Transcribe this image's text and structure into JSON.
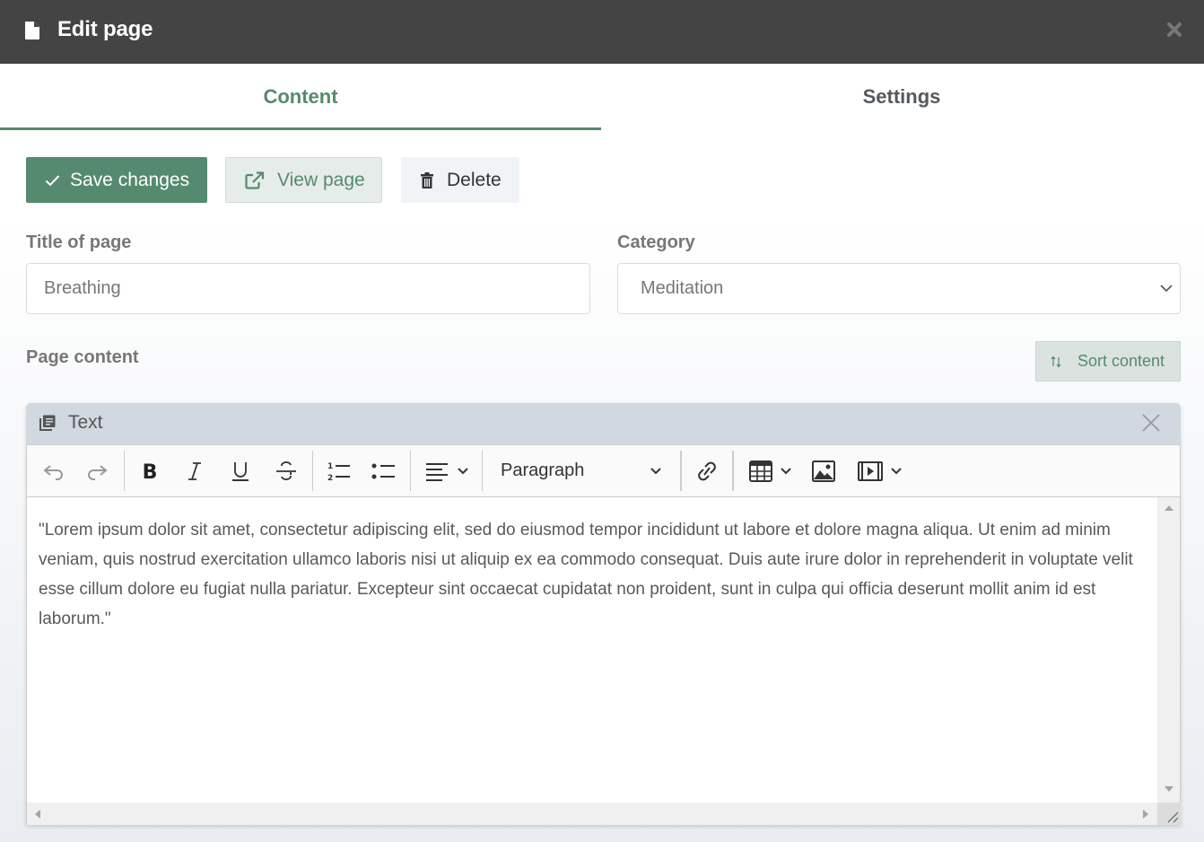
{
  "window": {
    "title": "Edit page",
    "title_icon": "file-icon",
    "close_icon": "close-icon"
  },
  "tabs": [
    {
      "label": "Content",
      "active": true
    },
    {
      "label": "Settings",
      "active": false
    }
  ],
  "actions": {
    "save_label": "Save changes",
    "view_label": "View page",
    "delete_label": "Delete"
  },
  "form": {
    "title_label": "Title of page",
    "title_value": "Breathing",
    "category_label": "Category",
    "category_value": "Meditation",
    "page_content_label": "Page content",
    "sort_label": "Sort content"
  },
  "block": {
    "type_label": "Text",
    "toolbar": {
      "buttons": [
        "undo",
        "redo",
        "bold",
        "italic",
        "underline",
        "strikethrough",
        "numbered-list",
        "bulleted-list",
        "align",
        "format",
        "link",
        "table",
        "image",
        "media"
      ],
      "format_value": "Paragraph"
    },
    "content": "\"Lorem ipsum dolor sit amet, consectetur adipiscing elit, sed do eiusmod tempor incididunt ut labore et dolore magna aliqua. Ut enim ad minim veniam, quis nostrud exercitation ullamco laboris nisi ut aliquip ex ea commodo consequat. Duis aute irure dolor in reprehenderit in voluptate velit esse cillum dolore eu fugiat nulla pariatur. Excepteur sint occaecat cupidatat non proident, sunt in culpa qui officia deserunt mollit anim id est laborum.\""
  },
  "colors": {
    "accent": "#558a6e",
    "titlebar": "#444444",
    "block_header": "#d1d8df"
  }
}
